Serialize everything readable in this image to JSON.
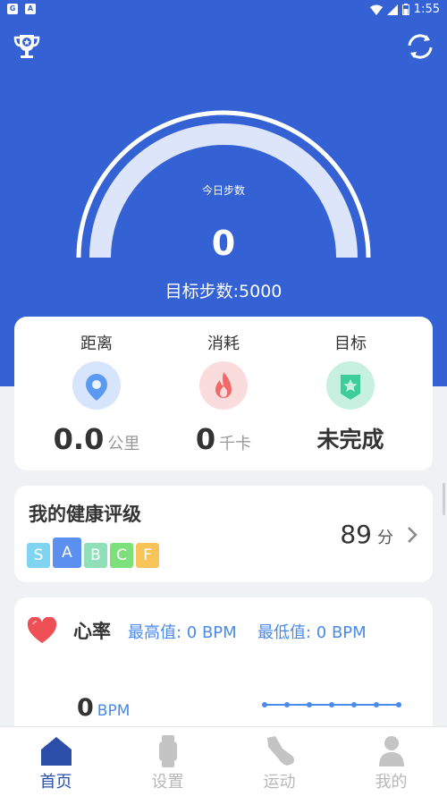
{
  "status_bar": {
    "time": "1:55"
  },
  "steps": {
    "label": "今日步数",
    "value": "0",
    "target": "目标步数:5000"
  },
  "stats": [
    {
      "title": "距离",
      "value": "0.0",
      "unit": "公里",
      "icon": "location-pin-icon"
    },
    {
      "title": "消耗",
      "value": "0",
      "unit": "千卡",
      "icon": "flame-icon"
    },
    {
      "title": "目标",
      "value": "未完成",
      "icon": "star-badge-icon"
    }
  ],
  "health": {
    "title": "我的健康评级",
    "grades": [
      "S",
      "A",
      "B",
      "C",
      "F"
    ],
    "selected_grade": "A",
    "score": "89",
    "score_unit": "分"
  },
  "heart_rate": {
    "title": "心率",
    "max": "最高值: 0 BPM",
    "min": "最低值: 0 BPM",
    "value": "0",
    "unit": "BPM"
  },
  "tabs": [
    {
      "label": "首页",
      "icon": "home-icon",
      "active": true
    },
    {
      "label": "设置",
      "icon": "watch-icon",
      "active": false
    },
    {
      "label": "运动",
      "icon": "sneaker-icon",
      "active": false
    },
    {
      "label": "我的",
      "icon": "user-icon",
      "active": false
    }
  ],
  "colors": {
    "primary": "#3461d3",
    "active_tab": "#2b4fa9",
    "accent_blue": "#4a8ae8",
    "heart": "#ee5056",
    "grade_S": "#7fd4f2",
    "grade_A": "#5b8ff0",
    "grade_B": "#8fe0b8",
    "grade_C": "#7ee07a",
    "grade_F": "#f8c45a"
  }
}
